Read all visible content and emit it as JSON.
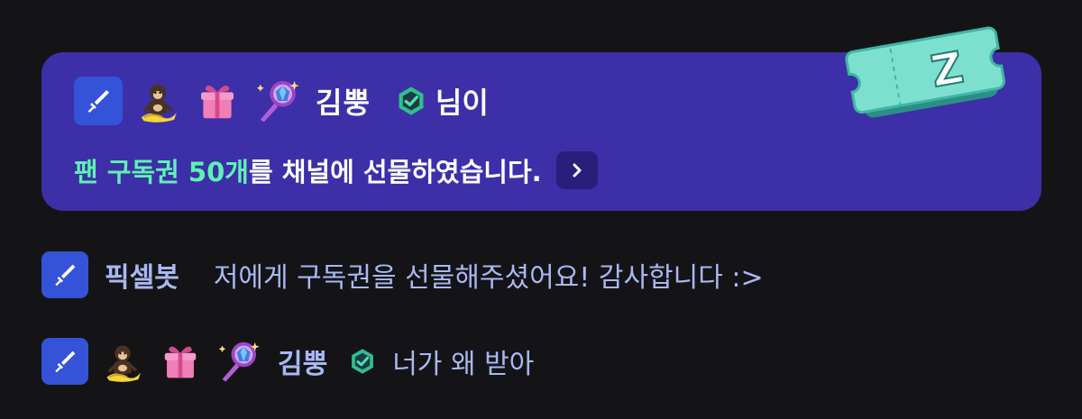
{
  "card": {
    "nickname": "김뿡",
    "suffix": "님이",
    "highlight": "팬 구독권 50개",
    "message": "를 채널에 선물하였습니다.",
    "more_icon": "chevron-right-icon",
    "ticket_letter": "Z",
    "colors": {
      "background": "#3d2fa8",
      "highlight": "#5ef2b3",
      "sword_badge": "#3553d8"
    }
  },
  "chat": [
    {
      "nickname": "픽셀봇",
      "message": "저에게 구독권을 선물해주셨어요! 감사합니다 :>",
      "badges": [
        "sword-badge-icon"
      ]
    },
    {
      "nickname": "김뿡",
      "message": "너가 왜 받아",
      "badges": [
        "sword-badge-icon",
        "monkey-banana-icon",
        "gift-box-icon",
        "magic-mirror-icon",
        "verified-icon"
      ]
    }
  ],
  "chat_text_color": "#a9b8f2"
}
